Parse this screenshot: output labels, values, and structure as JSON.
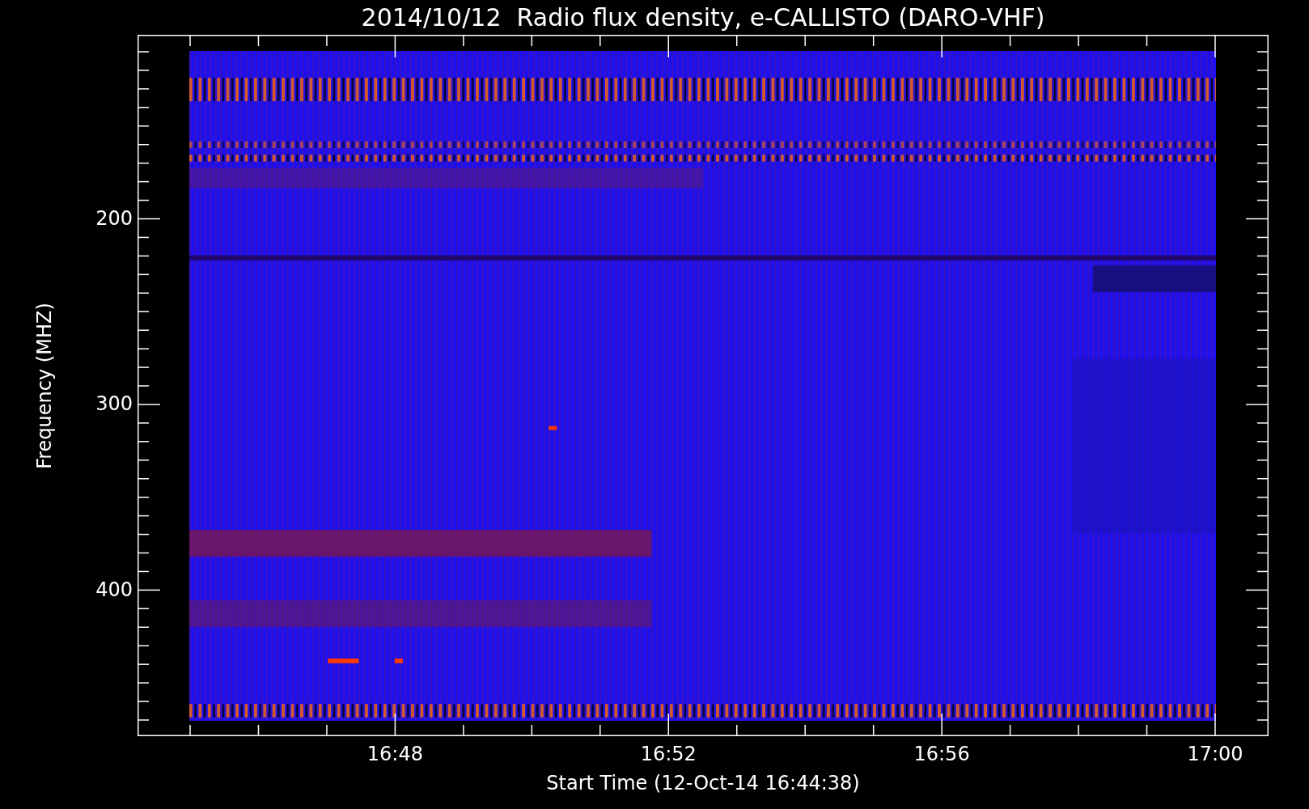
{
  "title": "2014/10/12  Radio flux density, e-CALLISTO (DARO-VHF)",
  "y_axis": {
    "label": "Frequency (MHZ)",
    "tick_labels": [
      "200",
      "300",
      "400"
    ]
  },
  "x_axis": {
    "label": "Start Time (12-Oct-14 16:44:38)",
    "tick_labels": [
      "16:48",
      "16:52",
      "16:56",
      "17:00"
    ]
  }
}
